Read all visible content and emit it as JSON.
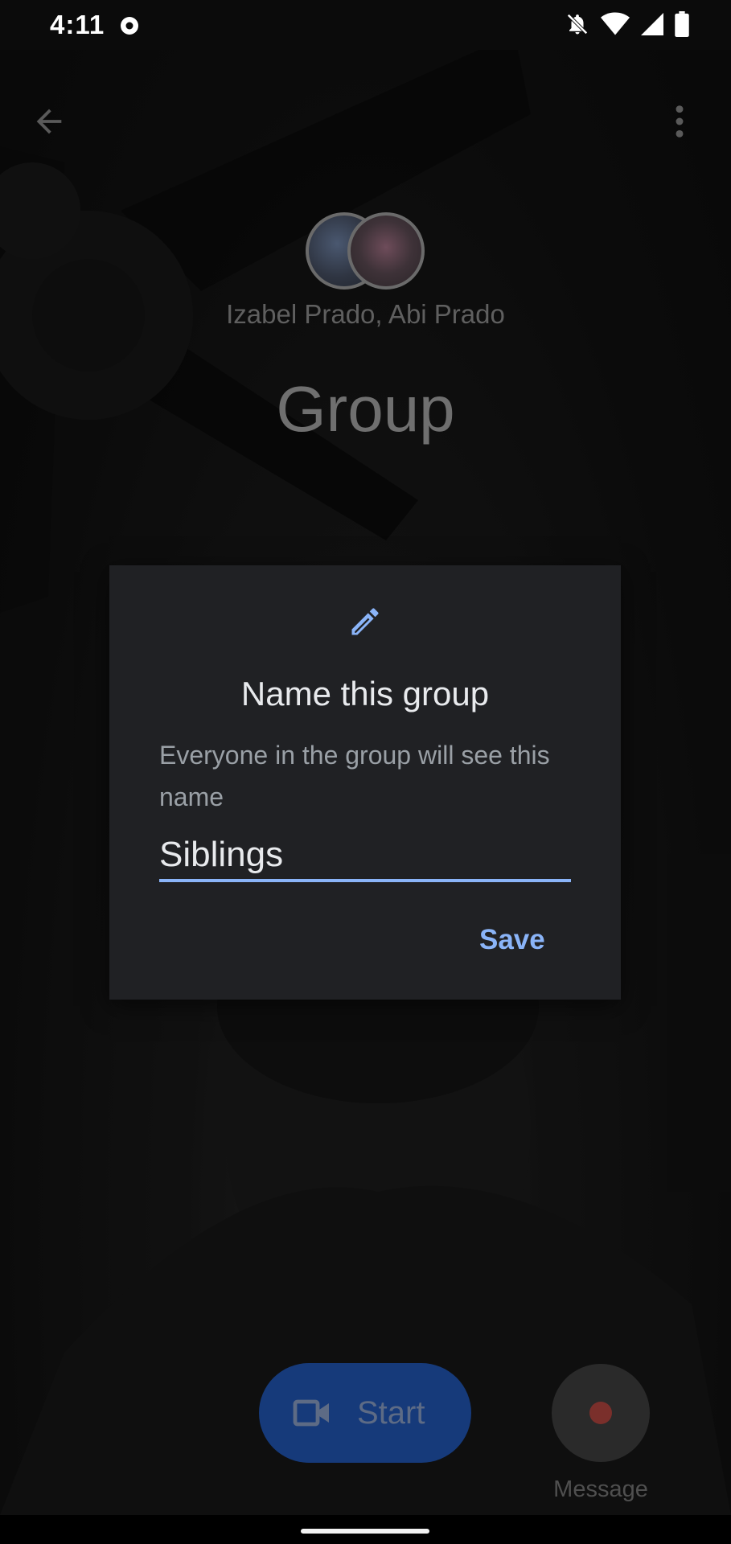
{
  "status_bar": {
    "time": "4:11",
    "icons": [
      "record-icon",
      "notifications-off-icon",
      "wifi-icon",
      "signal-icon",
      "battery-icon"
    ]
  },
  "header": {
    "back_icon": "arrow-back-icon",
    "more_icon": "more-vert-icon"
  },
  "group": {
    "participants": "Izabel Prado, Abi Prado",
    "title": "Group"
  },
  "dialog": {
    "icon": "edit-pencil-icon",
    "title": "Name this group",
    "description": "Everyone in the group will see this name",
    "input_value": "Siblings",
    "save_label": "Save"
  },
  "controls": {
    "start_label": "Start",
    "message_label": "Message"
  },
  "colors": {
    "accent": "#8ab4f8",
    "dialog_bg": "#202124",
    "start_button": "#163a7a",
    "record_dot": "#7a2f2b"
  }
}
